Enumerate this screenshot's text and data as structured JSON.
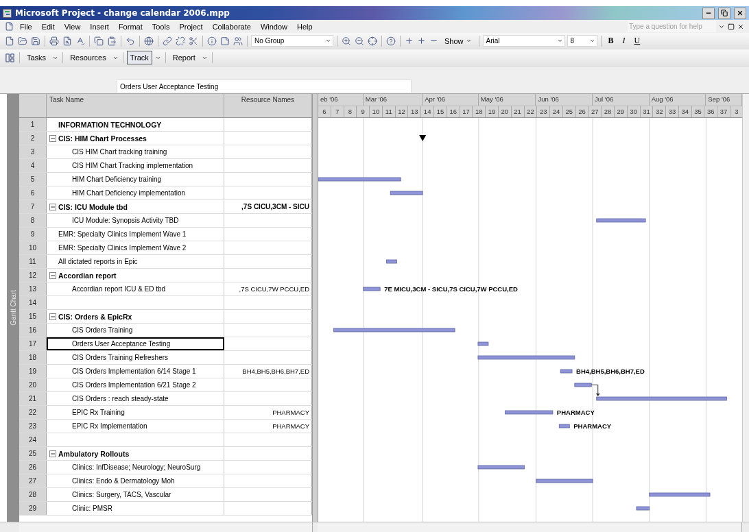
{
  "window": {
    "title": "Microsoft Project - change calendar 2006.mpp"
  },
  "menu": [
    "File",
    "Edit",
    "View",
    "Insert",
    "Format",
    "Tools",
    "Project",
    "Collaborate",
    "Window",
    "Help"
  ],
  "help_box": {
    "placeholder": "Type a question for help"
  },
  "standard_toolbar": {
    "group_select": "No Group",
    "show_button": "Show",
    "font": "Arial",
    "font_size": "8",
    "format_buttons": [
      {
        "label": "B",
        "kind": "bold"
      },
      {
        "label": "I",
        "kind": "italic"
      },
      {
        "label": "U",
        "kind": "underline"
      }
    ]
  },
  "guide_toolbar": [
    {
      "label": "Tasks",
      "selected": false
    },
    {
      "label": "Resources",
      "selected": false
    },
    {
      "label": "Track",
      "selected": true
    },
    {
      "label": "Report",
      "selected": false
    }
  ],
  "entry_bar": {
    "value": "Orders User Acceptance Testing"
  },
  "view_bar": {
    "label": "Gantt Chart"
  },
  "table": {
    "columns": [
      "Task Name",
      "Resource Names"
    ],
    "rows": [
      {
        "id": "1",
        "name": "INFORMATION TECHNOLOGY",
        "kind": "heading",
        "selected": false
      },
      {
        "id": "2",
        "name": "CIS:  HIM Chart Processes",
        "kind": "summary",
        "expanded": true,
        "selected": false,
        "children": [
          {
            "id": "3",
            "name": "CIS  HIM Chart tracking  training",
            "kind": "task",
            "selected": false
          },
          {
            "id": "4",
            "name": "CIS HIM Chart Tracking implementation",
            "kind": "task",
            "selected": false
          },
          {
            "id": "5",
            "name": "HIM Chart Deficiency training",
            "kind": "task",
            "selected": false
          },
          {
            "id": "6",
            "name": "HIM Chart Deficiency implementation",
            "kind": "task",
            "selected": false
          }
        ]
      },
      {
        "id": "7",
        "name": "CIS:  ICU Module  tbd",
        "resources": ",7S  CICU,3CM - SICU",
        "kind": "summary",
        "expanded": true,
        "selected": false,
        "children": [
          {
            "id": "8",
            "name": "ICU Module: Synopsis Activity  TBD",
            "kind": "task",
            "selected": false
          }
        ]
      },
      {
        "id": "9",
        "name": "EMR: Specialty Clinics Implement  Wave 1",
        "kind": "task",
        "selected": false
      },
      {
        "id": "10",
        "name": "EMR: Specialty Clinics Implement Wave 2",
        "kind": "task",
        "selected": false
      },
      {
        "id": "11",
        "name": "All dictated reports in Epic",
        "kind": "task",
        "selected": false
      },
      {
        "id": "12",
        "name": "Accordian report",
        "kind": "summary",
        "expanded": true,
        "selected": false,
        "children": [
          {
            "id": "13",
            "name": "Accordian report  ICU & ED  tbd",
            "resources": ",7S  CICU,7W  PCCU,ED",
            "bar_label": "7E  MICU,3CM - SICU,7S  CICU,7W  PCCU,ED",
            "kind": "task",
            "selected": false
          }
        ]
      },
      {
        "id": "14",
        "kind": "empty",
        "selected": false
      },
      {
        "id": "15",
        "name": "CIS:  Orders &  EpicRx",
        "kind": "summary",
        "expanded": true,
        "selected": false,
        "children": [
          {
            "id": "16",
            "name": "CIS Orders Training",
            "kind": "task",
            "selected": false
          },
          {
            "id": "17",
            "name": "Orders User Acceptance Testing",
            "kind": "task",
            "selected": true
          },
          {
            "id": "18",
            "name": "CIS Orders Training Refreshers",
            "kind": "task",
            "selected": false
          },
          {
            "id": "19",
            "name": "CIS Orders Implementation 6/14 Stage 1",
            "resources": "BH4,BH5,BH6,BH7,ED",
            "bar_label": "BH4,BH5,BH6,BH7,ED",
            "kind": "task",
            "selected": false
          },
          {
            "id": "20",
            "name": "CIS Orders Implementation 6/21 Stage 2",
            "kind": "task",
            "selected": false
          },
          {
            "id": "21",
            "name": "CIS Orders :  reach steady-state",
            "kind": "task",
            "selected": false
          },
          {
            "id": "22",
            "name": "EPIC Rx Training",
            "resources": "PHARMACY",
            "bar_label": "PHARMACY",
            "kind": "task",
            "selected": false
          },
          {
            "id": "23",
            "name": "EPIC Rx Implementation",
            "resources": "PHARMACY",
            "bar_label": "PHARMACY",
            "kind": "task",
            "selected": false
          }
        ]
      },
      {
        "id": "24",
        "kind": "empty",
        "selected": false
      },
      {
        "id": "25",
        "name": "Ambulatory Rollouts",
        "kind": "summary",
        "expanded": true,
        "selected": false,
        "children": [
          {
            "id": "26",
            "name": "Clinics:  InfDisease; Neurology; NeuroSurg",
            "kind": "task",
            "selected": false
          },
          {
            "id": "27",
            "name": "Clinics: Endo & Dermatology Moh",
            "kind": "task",
            "selected": false
          },
          {
            "id": "28",
            "name": "Clinics:  Surgery, TACS, Vascular",
            "kind": "task",
            "selected": false
          },
          {
            "id": "29",
            "name": "Clinic:  PMSR",
            "kind": "task",
            "selected": false
          }
        ]
      }
    ]
  },
  "gantt": {
    "months": [
      "eb '06",
      "Mar '06",
      "Apr '06",
      "May '06",
      "Jun '06",
      "Jul '06",
      "Aug '06",
      "Sep '06"
    ],
    "weeks": [
      "6",
      "7",
      "8",
      "9",
      "10",
      "11",
      "12",
      "13",
      "14",
      "15",
      "16",
      "17",
      "18",
      "19",
      "20",
      "21",
      "22",
      "23",
      "24",
      "25",
      "26",
      "27",
      "28",
      "29",
      "30",
      "31",
      "32",
      "33",
      "34",
      "35",
      "36",
      "37",
      "3"
    ]
  }
}
